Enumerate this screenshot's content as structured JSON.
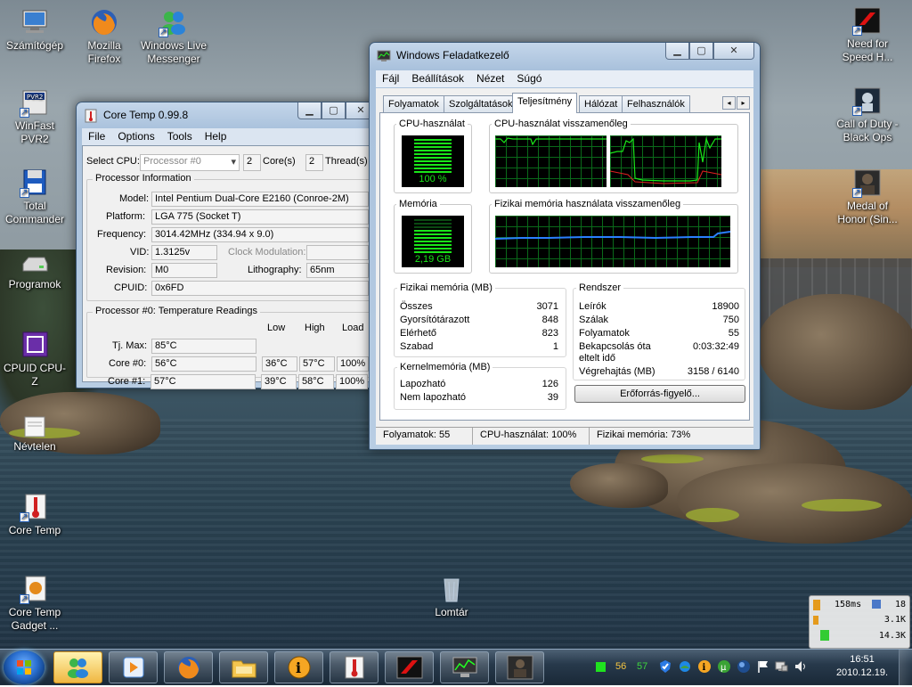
{
  "desktop_icons": [
    {
      "label": "Számítógép"
    },
    {
      "label": "Mozilla Firefox"
    },
    {
      "label": "Windows Live Messenger"
    },
    {
      "label": "WinFast PVR2"
    },
    {
      "label": "Total Commander"
    },
    {
      "label": "Programok"
    },
    {
      "label": "CPUID CPU-Z"
    },
    {
      "label": "Névtelen"
    },
    {
      "label": "Core Temp"
    },
    {
      "label": "Core Temp Gadget ..."
    },
    {
      "label": "Lomtár"
    },
    {
      "label": "Need for Speed H..."
    },
    {
      "label": "Call of Duty - Black Ops"
    },
    {
      "label": "Medal of Honor (Sin..."
    }
  ],
  "coretemp": {
    "title": "Core Temp 0.99.8",
    "menu": [
      "File",
      "Options",
      "Tools",
      "Help"
    ],
    "select_cpu_label": "Select CPU:",
    "select_cpu_value": "Processor #0",
    "cores": "2",
    "cores_label": "Core(s)",
    "threads": "2",
    "threads_label": "Thread(s)",
    "proc_info_title": "Processor Information",
    "model_label": "Model:",
    "model": "Intel Pentium Dual-Core E2160 (Conroe-2M)",
    "platform_label": "Platform:",
    "platform": "LGA 775 (Socket T)",
    "frequency_label": "Frequency:",
    "frequency": "3014.42MHz (334.94 x 9.0)",
    "vid_label": "VID:",
    "vid": "1.3125v",
    "clock_mod_label": "Clock Modulation:",
    "clock_mod": "",
    "revision_label": "Revision:",
    "revision": "M0",
    "lithography_label": "Lithography:",
    "lithography": "65nm",
    "cpuid_label": "CPUID:",
    "cpuid": "0x6FD",
    "temps_title": "Processor #0: Temperature Readings",
    "col_low": "Low",
    "col_high": "High",
    "col_load": "Load",
    "tjmax_label": "Tj. Max:",
    "tjmax": "85°C",
    "core0_label": "Core #0:",
    "core0": {
      "temp": "56°C",
      "low": "36°C",
      "high": "57°C",
      "load": "100%"
    },
    "core1_label": "Core #1:",
    "core1": {
      "temp": "57°C",
      "low": "39°C",
      "high": "58°C",
      "load": "100%"
    }
  },
  "taskmgr": {
    "title": "Windows Feladatkezelő",
    "menu": [
      "Fájl",
      "Beállítások",
      "Nézet",
      "Súgó"
    ],
    "tabs": [
      "Folyamatok",
      "Szolgáltatások",
      "Teljesítmény",
      "Hálózat",
      "Felhasználók"
    ],
    "active_tab": "Teljesítmény",
    "cpu_usage_title": "CPU-használat",
    "cpu_usage_value": "100 %",
    "cpu_usage_fraction": 1.0,
    "cpu_history_title": "CPU-használat visszamenőleg",
    "memory_title": "Memória",
    "memory_value": "2,19 GB",
    "memory_fraction": 0.73,
    "mem_history_title": "Fizikai memória használata visszamenőleg",
    "phys_mem": {
      "title": "Fizikai memória (MB)",
      "rows": [
        {
          "label": "Összes",
          "value": "3071"
        },
        {
          "label": "Gyorsítótárazott",
          "value": "848"
        },
        {
          "label": "Elérhető",
          "value": "823"
        },
        {
          "label": "Szabad",
          "value": "1"
        }
      ]
    },
    "kernel_mem": {
      "title": "Kernelmemória (MB)",
      "rows": [
        {
          "label": "Lapozható",
          "value": "126"
        },
        {
          "label": "Nem lapozható",
          "value": "39"
        }
      ]
    },
    "system": {
      "title": "Rendszer",
      "rows": [
        {
          "label": "Leírók",
          "value": "18900"
        },
        {
          "label": "Szálak",
          "value": "750"
        },
        {
          "label": "Folyamatok",
          "value": "55"
        },
        {
          "label": "Bekapcsolás óta",
          "value": "0:03:32:49"
        },
        {
          "label": "eltelt idő",
          "value": ""
        },
        {
          "label": "Végrehajtás (MB)",
          "value": "3158 / 6140"
        }
      ]
    },
    "resource_button": "Erőforrás-figyelő...",
    "status": {
      "processes": "Folyamatok: 55",
      "cpu": "CPU-használat: 100%",
      "memory": "Fizikai memória: 73%"
    }
  },
  "gadget": {
    "ping": "158ms",
    "count": "18",
    "down": "3.1K",
    "up": "14.3K"
  },
  "tray": {
    "num1": "56",
    "num2": "57",
    "time": "16:51",
    "date": "2010.12.19."
  },
  "taskbar": {
    "buttons": [
      "messenger-icon",
      "media-icon",
      "firefox-icon",
      "explorer-icon",
      "info-icon",
      "coretemp-icon",
      "nfs-icon",
      "taskmgr-icon",
      "game-icon"
    ]
  },
  "colors": {
    "graph_green": "#19e619",
    "graph_blue": "#2a7fff",
    "taskbar_active": "#f0b742"
  }
}
